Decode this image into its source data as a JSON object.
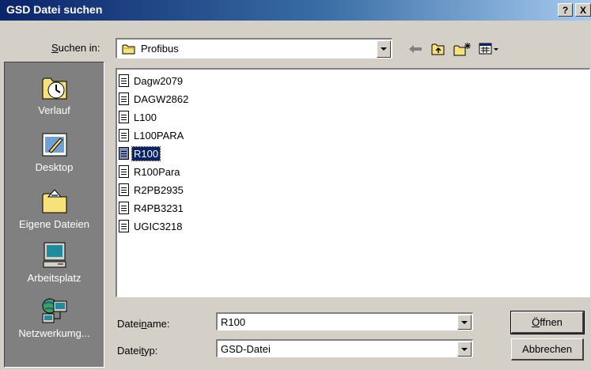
{
  "window": {
    "title": "GSD Datei suchen",
    "help_label": "?",
    "close_label": "X"
  },
  "lookin": {
    "label_pre": "",
    "label_accel": "S",
    "label_post": "uchen in:",
    "value": "Profibus"
  },
  "toolbar": {
    "icons": [
      "back-arrow-icon",
      "up-folder-icon",
      "new-folder-icon",
      "view-menu-icon"
    ]
  },
  "places": [
    {
      "label": "Verlauf",
      "icon": "history-icon"
    },
    {
      "label": "Desktop",
      "icon": "desktop-icon"
    },
    {
      "label": "Eigene Dateien",
      "icon": "my-documents-icon"
    },
    {
      "label": "Arbeitsplatz",
      "icon": "my-computer-icon"
    },
    {
      "label": "Netzwerkumg...",
      "icon": "network-icon"
    }
  ],
  "files": [
    "Dagw2079",
    "DAGW2862",
    "L100",
    "L100PARA",
    "R100",
    "R100Para",
    "R2PB2935",
    "R4PB3231",
    "UGIC3218"
  ],
  "selected_file": "R100",
  "filename": {
    "label_pre": "Datei",
    "label_accel": "n",
    "label_post": "ame:",
    "value": "R100"
  },
  "filetype": {
    "label_pre": "Datei",
    "label_accel": "t",
    "label_post": "yp:",
    "value": "GSD-Datei"
  },
  "buttons": {
    "open_accel": "Ö",
    "open_rest": "ffnen",
    "cancel": "Abbrechen"
  },
  "colors": {
    "title_start": "#0a246a",
    "title_end": "#a6caf0",
    "face": "#d4d0c8",
    "places_bg": "#808080",
    "selection": "#0a246a"
  }
}
